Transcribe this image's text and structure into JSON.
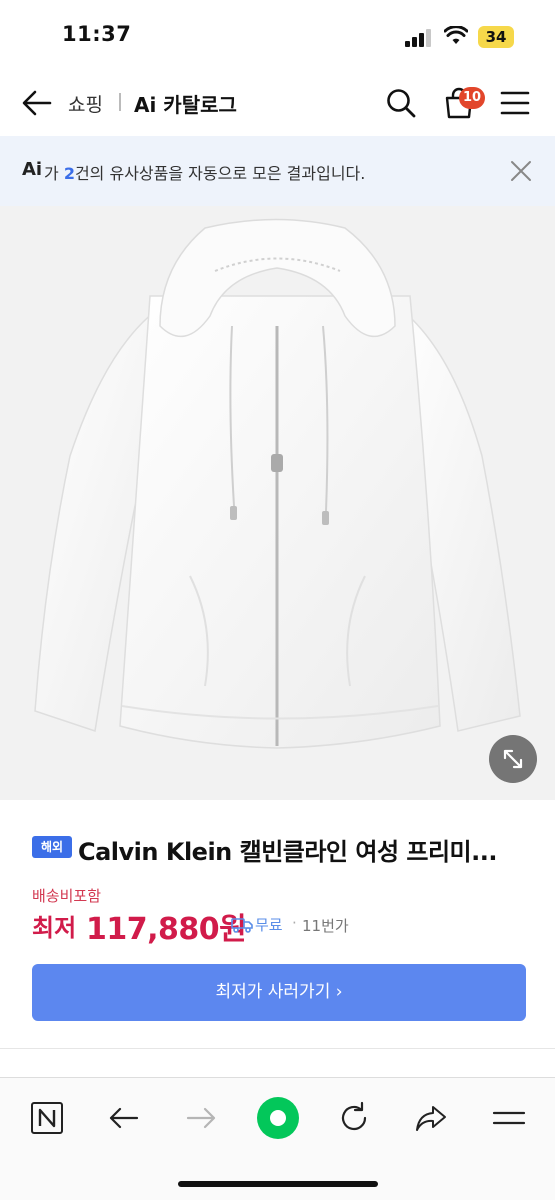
{
  "status_bar": {
    "time": "11:37",
    "battery": "34"
  },
  "header": {
    "breadcrumb_shopping": "쇼핑",
    "breadcrumb_catalog": "Ai 카탈로그",
    "cart_count": "10"
  },
  "ai_notice": {
    "logo": "Ai",
    "prefix": "가 ",
    "count": "2",
    "suffix": "건의 유사상품을 자동으로 모은 결과입니다."
  },
  "product": {
    "badge": "해외",
    "title": "Calvin Klein 캘빈클라인 여성 프리미...",
    "shipping_note": "배송비포함",
    "price_label": "최저",
    "price": "117,880원",
    "free_shipping": "무료",
    "separator": "·",
    "seller": "11번가",
    "buy_button": "최저가 사러가기 ›"
  },
  "bottom_nav": {
    "icons": [
      "naver-n-icon",
      "back-arrow-icon",
      "forward-arrow-icon",
      "green-home-icon",
      "refresh-icon",
      "share-icon",
      "menu-icon"
    ]
  },
  "colors": {
    "accent_blue": "#5c87ef",
    "price_red": "#d11b4a",
    "badge_red": "#e2462b",
    "notice_bg": "#eef3fb",
    "green": "#03c75a"
  }
}
